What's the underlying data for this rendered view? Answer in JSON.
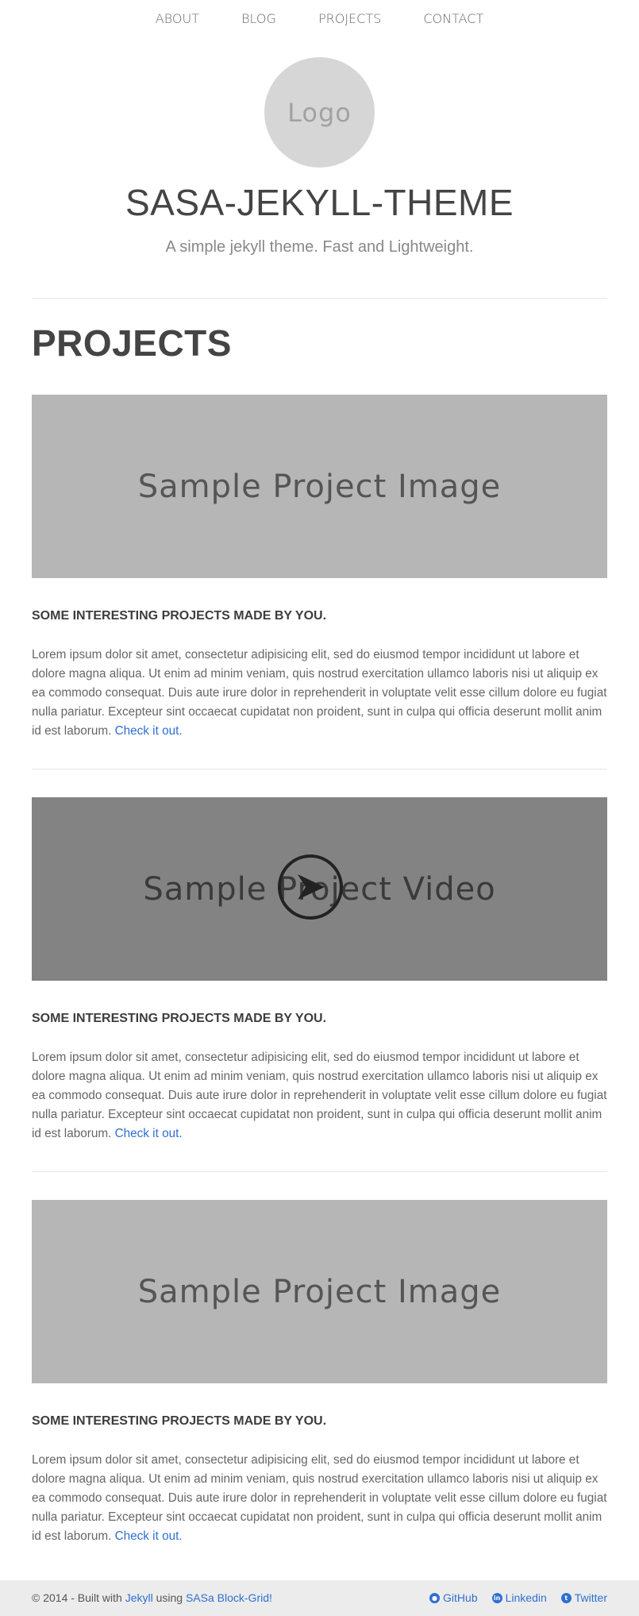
{
  "nav": {
    "items": [
      {
        "label": "ABOUT"
      },
      {
        "label": "BLOG"
      },
      {
        "label": "PROJECTS"
      },
      {
        "label": "CONTACT"
      }
    ]
  },
  "header": {
    "logo_text": "Logo",
    "site_title": "SASA-JEKYLL-THEME",
    "site_description": "A simple jekyll theme. Fast and Lightweight."
  },
  "main": {
    "page_heading": "PROJECTS",
    "projects": [
      {
        "media_type": "image",
        "media_label": "Sample Project Image",
        "title": "SOME INTERESTING PROJECTS MADE BY YOU.",
        "body": "Lorem ipsum dolor sit amet, consectetur adipisicing elit, sed do eiusmod tempor incididunt ut labore et dolore magna aliqua. Ut enim ad minim veniam, quis nostrud exercitation ullamco laboris nisi ut aliquip ex ea commodo consequat. Duis aute irure dolor in reprehenderit in voluptate velit esse cillum dolore eu fugiat nulla pariatur. Excepteur sint occaecat cupidatat non proident, sunt in culpa qui officia deserunt mollit anim id est laborum.",
        "link_label": "Check it out."
      },
      {
        "media_type": "video",
        "media_label": "Sample Project Video",
        "title": "SOME INTERESTING PROJECTS MADE BY YOU.",
        "body": "Lorem ipsum dolor sit amet, consectetur adipisicing elit, sed do eiusmod tempor incididunt ut labore et dolore magna aliqua. Ut enim ad minim veniam, quis nostrud exercitation ullamco laboris nisi ut aliquip ex ea commodo consequat. Duis aute irure dolor in reprehenderit in voluptate velit esse cillum dolore eu fugiat nulla pariatur. Excepteur sint occaecat cupidatat non proident, sunt in culpa qui officia deserunt mollit anim id est laborum.",
        "link_label": "Check it out."
      },
      {
        "media_type": "image",
        "media_label": "Sample Project Image",
        "title": "SOME INTERESTING PROJECTS MADE BY YOU.",
        "body": "Lorem ipsum dolor sit amet, consectetur adipisicing elit, sed do eiusmod tempor incididunt ut labore et dolore magna aliqua. Ut enim ad minim veniam, quis nostrud exercitation ullamco laboris nisi ut aliquip ex ea commodo consequat. Duis aute irure dolor in reprehenderit in voluptate velit esse cillum dolore eu fugiat nulla pariatur. Excepteur sint occaecat cupidatat non proident, sunt in culpa qui officia deserunt mollit anim id est laborum.",
        "link_label": "Check it out."
      }
    ]
  },
  "footer": {
    "prefix": "© 2014 - Built with ",
    "jekyll_link": "Jekyll",
    "middle": " using ",
    "grid_link": "SASa Block-Grid!",
    "social": [
      {
        "label": "GitHub",
        "icon": "github-icon"
      },
      {
        "label": "Linkedin",
        "icon": "linkedin-icon"
      },
      {
        "label": "Twitter",
        "icon": "twitter-icon"
      }
    ]
  },
  "colors": {
    "accent_link": "#2f6fd1",
    "image_placeholder": "#b6b6b6",
    "video_placeholder": "#838383",
    "footer_bg": "#ececec"
  }
}
